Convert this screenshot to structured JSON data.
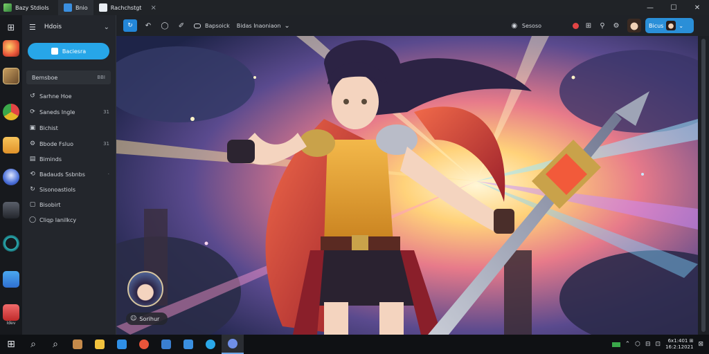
{
  "titlebar": {
    "app_title": "Bazy Stdiols",
    "tabs": [
      {
        "label": "Bnio",
        "active": true,
        "color": "#3a8fe0"
      },
      {
        "label": "Rachchstgt",
        "active": false,
        "color": "#e9eef4"
      }
    ],
    "close_glyph": "×",
    "controls": {
      "minimize": "—",
      "maximize": "☐",
      "close": "✕"
    }
  },
  "dock": {
    "items": [
      {
        "icon": "grid-icon",
        "glyph": "⊞"
      },
      {
        "icon": "fire-app-icon",
        "color": "#e8553a"
      },
      {
        "icon": "hero-thumb-icon",
        "color": "#8a6a3a"
      },
      {
        "icon": "chrome-icon",
        "color": "#e5b829"
      },
      {
        "icon": "folder-app-icon",
        "color": "#f2a93b"
      },
      {
        "icon": "blue-avatar-icon",
        "color": "#4a6fd8"
      },
      {
        "icon": "dark-avatar-icon",
        "color": "#3b3f48"
      },
      {
        "icon": "teal-ring-icon",
        "color": "#2bb3b8"
      },
      {
        "icon": "chat-app-icon",
        "color": "#2f8fe6"
      },
      {
        "icon": "red-app-icon",
        "color": "#e24545"
      }
    ],
    "bottom_label": "Idev"
  },
  "panel": {
    "header": {
      "title": "Hdois",
      "menu_glyph": "☰",
      "chevron_glyph": "⌄"
    },
    "primary_button": "Baciesra",
    "section": {
      "label": "Bemsboe",
      "badge": "BBI"
    },
    "nav": [
      {
        "label": "Sarhne Hoe",
        "icon": "history-icon",
        "glyph": "↺",
        "count": ""
      },
      {
        "label": "Saneds Ingle",
        "icon": "refresh-icon",
        "glyph": "⟳",
        "count": "31"
      },
      {
        "label": "Bichist",
        "icon": "image-icon",
        "glyph": "▣",
        "count": ""
      },
      {
        "label": "Bbode Fsluo",
        "icon": "gear-icon",
        "glyph": "⚙",
        "count": "31"
      },
      {
        "label": "Biminds",
        "icon": "file-icon",
        "glyph": "▤",
        "count": ""
      },
      {
        "label": "Badauds Ssbnbs",
        "icon": "sync-icon",
        "glyph": "⟲",
        "count": "·"
      },
      {
        "label": "Sisonoastiols",
        "icon": "refresh-alt-icon",
        "glyph": "↻",
        "count": ""
      },
      {
        "label": "Bisobirt",
        "icon": "box-icon",
        "glyph": "▢",
        "count": ""
      },
      {
        "label": "Cliqp lanilkcy",
        "icon": "circle-icon",
        "glyph": "◯",
        "count": ""
      }
    ]
  },
  "toolbar": {
    "primary_glyph": "↻",
    "undo_glyph": "↶",
    "circle_glyph": "◯",
    "brush_glyph": "✐",
    "dropdown_label": "Bapsoick",
    "subdropdown_label": "Bidas Inaoniaon",
    "share_label": "Sesoso",
    "share_glyph": "◉",
    "account_label": "Bicus",
    "chevron_glyph": "⌄"
  },
  "canvas": {
    "avatar_chip_label": "Sorihur"
  },
  "taskbar": {
    "start_glyph": "⊞",
    "apps": [
      {
        "icon": "search-icon",
        "glyph": "⌕",
        "color": "#d6d9de"
      },
      {
        "icon": "search-alt-icon",
        "glyph": "⌕",
        "color": "#d6d9de"
      },
      {
        "icon": "store-icon",
        "color": "#c58a4a"
      },
      {
        "icon": "folder-icon",
        "color": "#f2c23d"
      },
      {
        "icon": "shield-icon",
        "color": "#2f8fe6"
      },
      {
        "icon": "media-icon",
        "color": "#e8553a"
      },
      {
        "icon": "photo-icon",
        "color": "#3a7fd0"
      },
      {
        "icon": "doc-icon",
        "color": "#3a8fe0"
      },
      {
        "icon": "ie-icon",
        "color": "#2aa7e8"
      },
      {
        "icon": "app-active-icon",
        "color": "#6f8fe8"
      }
    ],
    "tray_icons": [
      "⌃",
      "⬡",
      "⊟",
      "⊡",
      "⊠"
    ],
    "clock_time": "6x1:401 ⊞",
    "clock_date": "16:2:12021"
  }
}
